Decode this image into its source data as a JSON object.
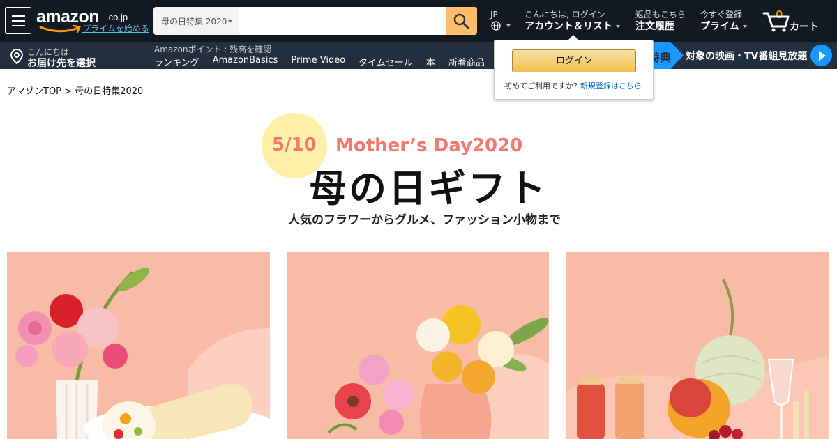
{
  "header": {
    "logo_text": "amazon",
    "logo_tld": ".co.jp",
    "logo_prime_link": "プライムを始める",
    "search_dept": "母の日特集 2020",
    "search_placeholder": "",
    "lang_code": "JP",
    "account_line1": "こんにちは, ログイン",
    "account_line2": "アカウント＆リスト",
    "orders_line1": "返品もこちら",
    "orders_line2": "注文履歴",
    "prime_line1": "今すぐ登録",
    "prime_line2": "プライム",
    "cart_count": "0",
    "cart_label": "カート"
  },
  "subnav": {
    "deliver_line1": "こんにちは",
    "deliver_line2": "お届け先を選択",
    "points": "Amazonポイント : 残高を確認",
    "links": [
      "ランキング",
      "AmazonBasics",
      "Prime Video",
      "タイムセール",
      "本",
      "新着商品"
    ],
    "promo_tag": "特典",
    "promo_text": "対象の映画・TV番組見放題"
  },
  "signin_flyout": {
    "button": "ログイン",
    "note": "初めてご利用ですか?",
    "register_link": "新規登録はこちら"
  },
  "breadcrumb": {
    "root": "アマゾンTOP",
    "separator": " > ",
    "current": "母の日特集2020"
  },
  "hero": {
    "date": "5/10",
    "english": "Mother’s Day2020",
    "title": "母の日ギフト",
    "subtitle": "人気のフラワーからグルメ、ファッション小物まで"
  },
  "colors": {
    "nav_dark": "#131921",
    "nav_sub": "#232f3e",
    "search_button": "#febd69",
    "accent_orange": "#f08804",
    "hero_coral": "#f27b6b",
    "hero_circle": "#fff0a8",
    "tile_background": "#f8b9a3",
    "prime_blue": "#1a98ff"
  },
  "tiles": [
    {
      "icon": "flowers-and-roll-cake-image"
    },
    {
      "icon": "flower-bouquet-image"
    },
    {
      "icon": "fruit-and-juice-gift-image"
    }
  ]
}
